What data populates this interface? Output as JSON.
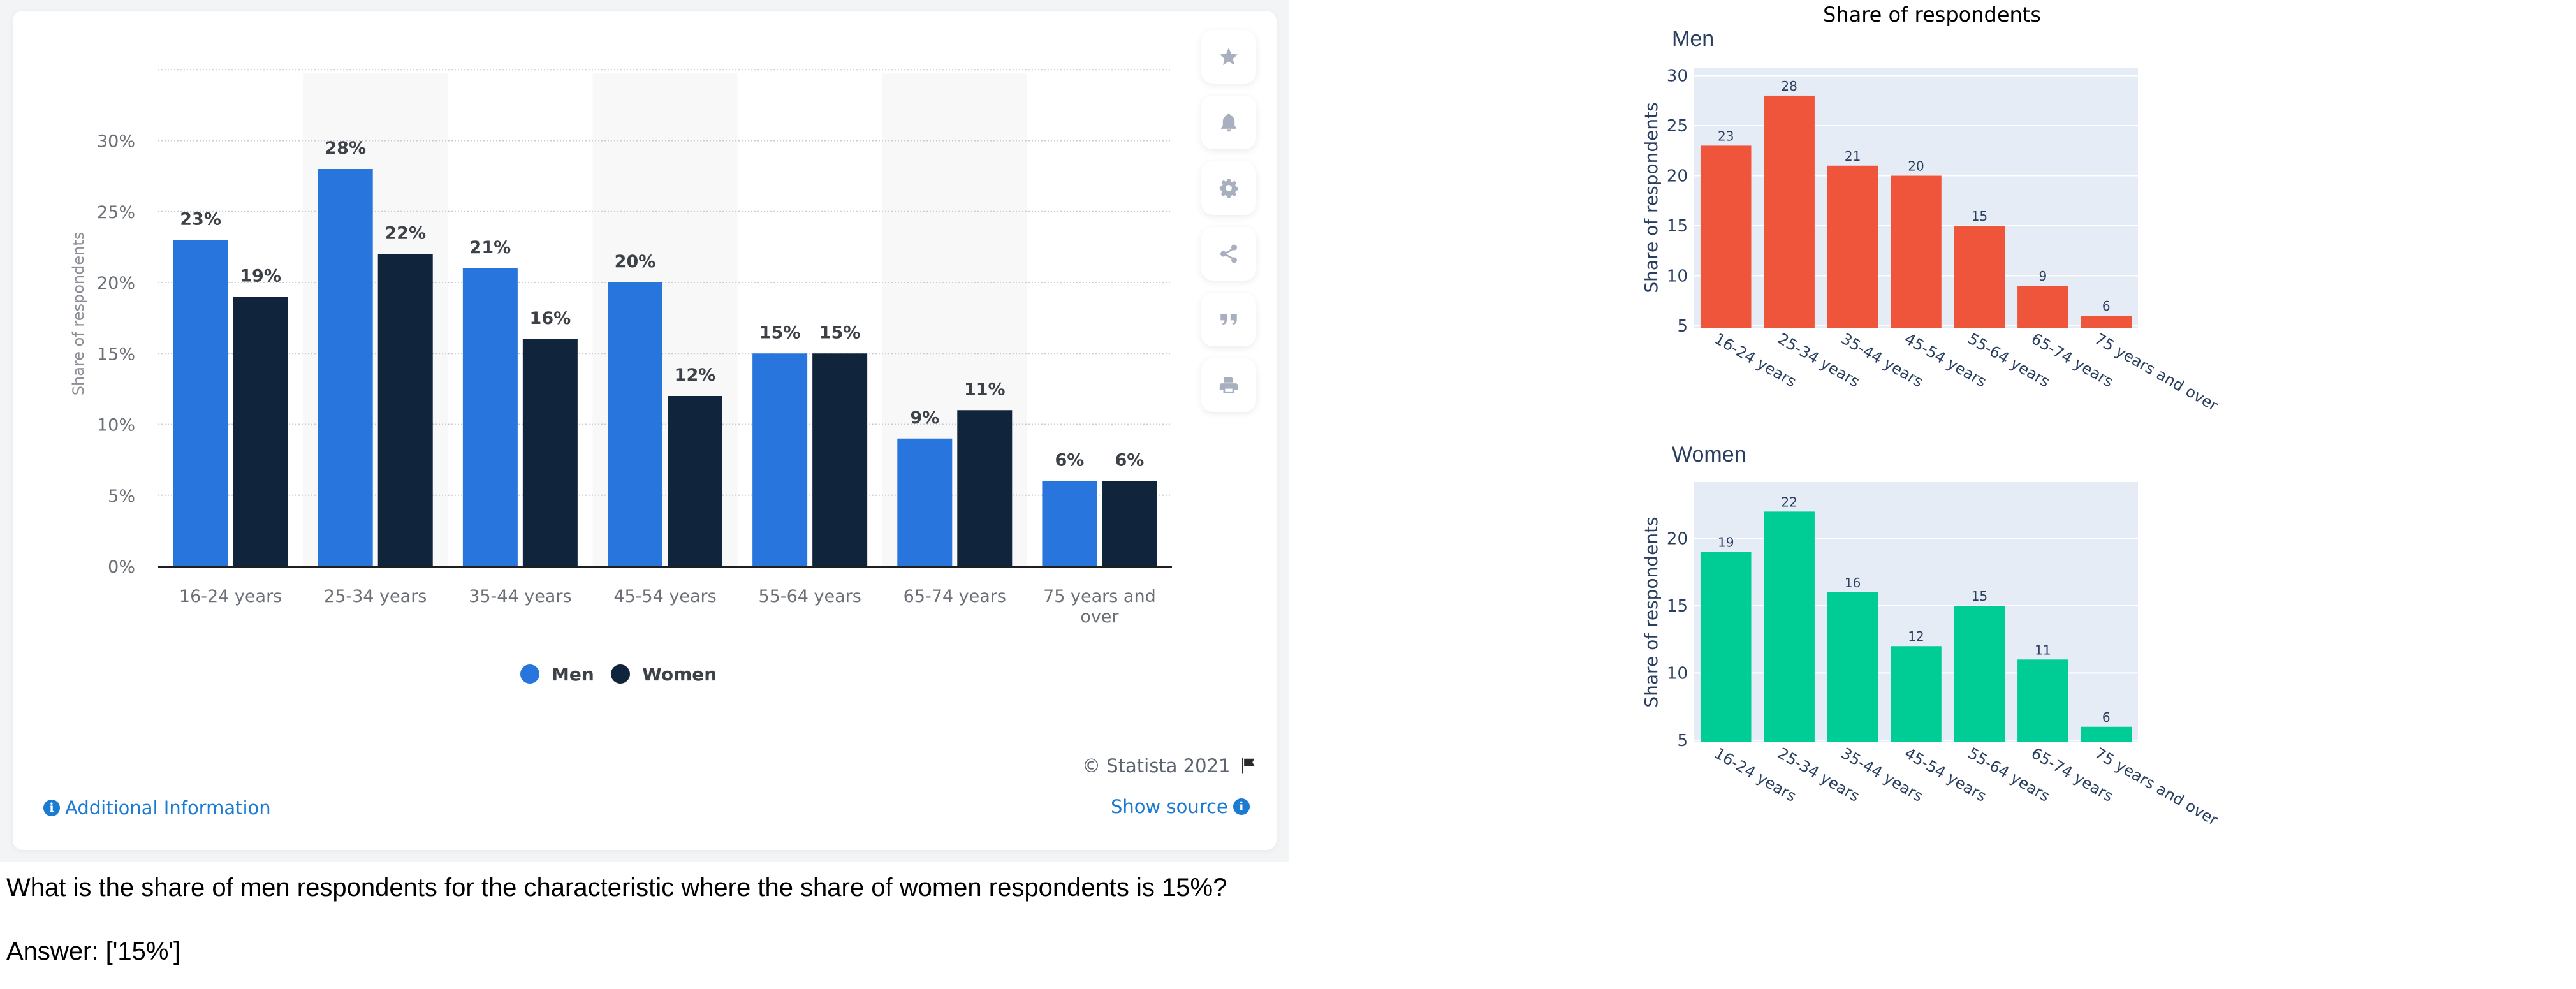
{
  "statista": {
    "legend": [
      {
        "name": "Men",
        "color": "#2876dd"
      },
      {
        "name": "Women",
        "color": "#10243c"
      }
    ],
    "copyright": "© Statista 2021",
    "additional_info": "Additional Information",
    "show_source": "Show source",
    "toolbar_icons": [
      "star-icon",
      "bell-icon",
      "gear-icon",
      "share-icon",
      "quote-icon",
      "print-icon"
    ]
  },
  "question": "What is the share of men respondents for the characteristic where the share of women respondents is 15%?",
  "answer": "Answer: ['15%']",
  "plotly": {
    "title": "Share of respondents",
    "men_title": "Men",
    "women_title": "Women"
  },
  "chart_data": [
    {
      "type": "bar",
      "title": "",
      "xlabel": "",
      "ylabel": "Share of respondents",
      "categories": [
        "16-24 years",
        "25-34 years",
        "35-44 years",
        "45-54 years",
        "55-64 years",
        "65-74 years",
        "75 years and over"
      ],
      "series": [
        {
          "name": "Men",
          "values": [
            23,
            28,
            21,
            20,
            15,
            9,
            6
          ],
          "color": "#2876dd"
        },
        {
          "name": "Women",
          "values": [
            19,
            22,
            16,
            12,
            15,
            11,
            6
          ],
          "color": "#10243c"
        }
      ],
      "value_suffix": "%",
      "yticks": [
        "0%",
        "5%",
        "10%",
        "15%",
        "20%",
        "25%",
        "30%"
      ],
      "ytick_values": [
        0,
        5,
        10,
        15,
        20,
        25,
        30
      ],
      "ylim": [
        0,
        35
      ],
      "grid": true,
      "legend": "bottom-center"
    },
    {
      "type": "bar",
      "title": "Men",
      "xlabel": "",
      "ylabel": "Share of respondents",
      "categories": [
        "16-24 years",
        "25-34 years",
        "35-44 years",
        "45-54 years",
        "55-64 years",
        "65-74 years",
        "75 years and over"
      ],
      "values": [
        23,
        28,
        21,
        20,
        15,
        9,
        6
      ],
      "color": "#ef553b",
      "ytick_values": [
        5,
        10,
        15,
        20,
        25,
        30
      ],
      "ylim": [
        4.8,
        30.8
      ],
      "grid": true
    },
    {
      "type": "bar",
      "title": "Women",
      "xlabel": "",
      "ylabel": "Share of respondents",
      "categories": [
        "16-24 years",
        "25-34 years",
        "35-44 years",
        "45-54 years",
        "55-64 years",
        "65-74 years",
        "75 years and over"
      ],
      "values": [
        19,
        22,
        16,
        12,
        15,
        11,
        6
      ],
      "color": "#00cc96",
      "ytick_values": [
        5,
        10,
        15,
        20
      ],
      "ylim": [
        4.85,
        24.2
      ],
      "grid": true
    }
  ]
}
